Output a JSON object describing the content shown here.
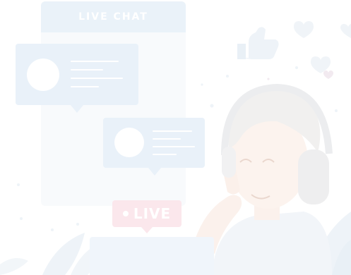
{
  "chat_window": {
    "title": "LIVE CHAT"
  },
  "live_badge": {
    "label": "LIVE"
  },
  "colors": {
    "chat_header": "#eaf2f9",
    "bubble": "#e9f1f9",
    "live_badge": "#fbe7ec",
    "accent_light": "#f2f6fa"
  },
  "icons": [
    "thumbs-up-icon",
    "heart-icon",
    "headset-icon"
  ]
}
